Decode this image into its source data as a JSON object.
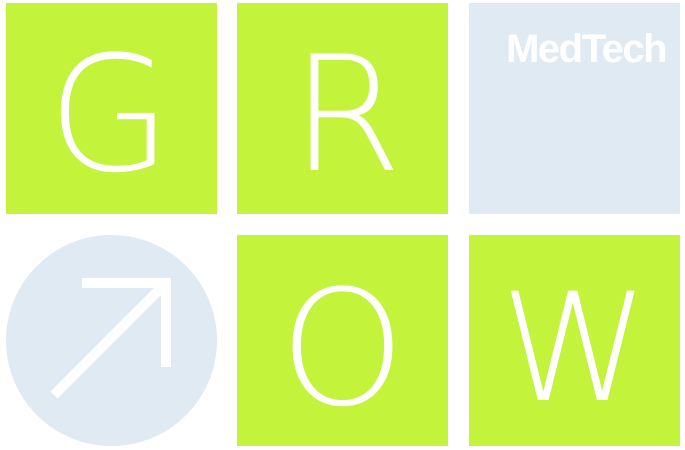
{
  "logo": {
    "text": "MedTech"
  },
  "letters": {
    "g": "G",
    "r": "R",
    "o": "O",
    "w": "W"
  },
  "icons": {
    "arrow": "arrow-up-right-icon"
  },
  "colors": {
    "lime_green": "#c4f33c",
    "pale_blue": "#dfeaf3",
    "white": "#ffffff"
  }
}
